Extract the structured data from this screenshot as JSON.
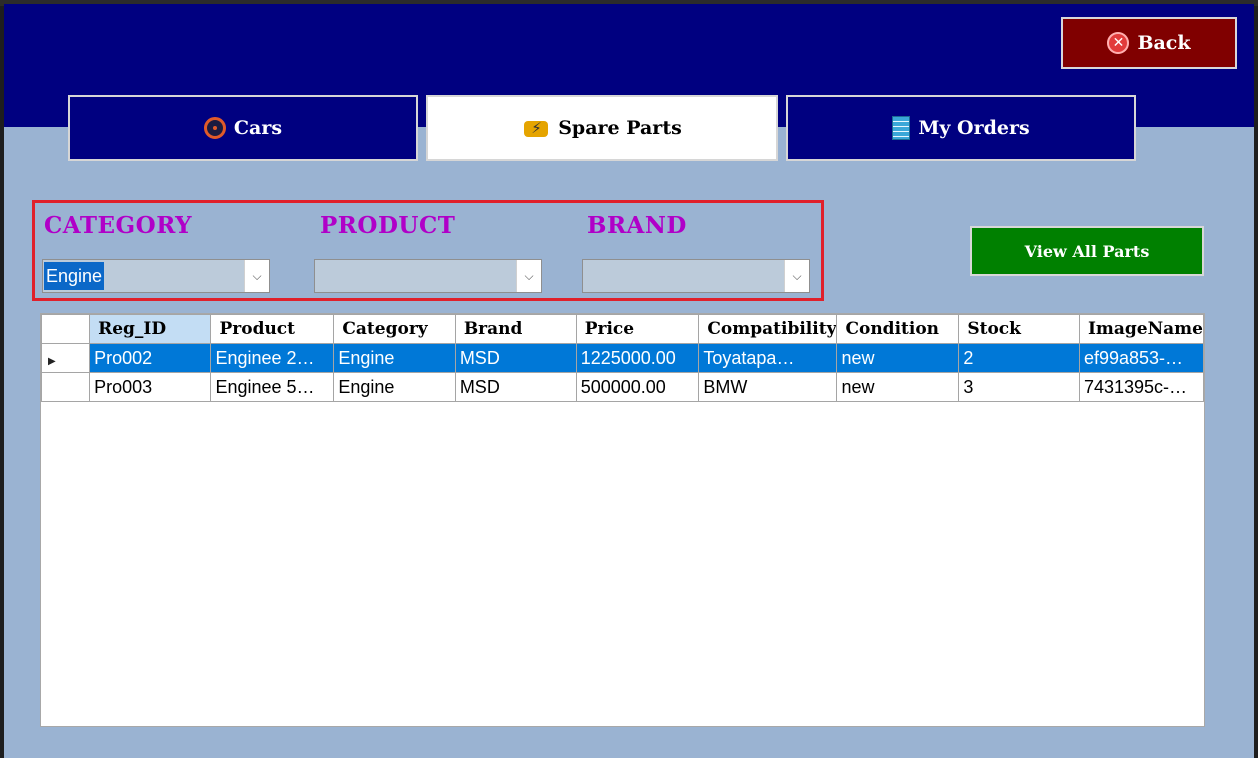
{
  "header": {
    "back_label": "Back"
  },
  "tabs": [
    {
      "label": "Cars",
      "icon": "steering-wheel-icon",
      "active": false
    },
    {
      "label": "Spare Parts",
      "icon": "engine-icon",
      "active": true
    },
    {
      "label": "My Orders",
      "icon": "receipt-icon",
      "active": false
    }
  ],
  "filters": {
    "category_label": "CATEGORY",
    "category_value": "Engine",
    "product_label": "PRODUCT",
    "product_value": "",
    "brand_label": "BRAND",
    "brand_value": ""
  },
  "view_all_label": "View All Parts",
  "grid": {
    "columns": [
      "Reg_ID",
      "Product",
      "Category",
      "Brand",
      "Price",
      "Compatibility",
      "Condition",
      "Stock",
      "ImageName"
    ],
    "rows": [
      [
        "Pro002",
        "Enginee 2…",
        "Engine",
        "MSD",
        "1225000.00",
        "Toyatapa…",
        "new",
        "2",
        "ef99a853-…"
      ],
      [
        "Pro003",
        "Enginee 5…",
        "Engine",
        "MSD",
        "500000.00",
        "BMW",
        "new",
        "3",
        "7431395c-…"
      ]
    ]
  },
  "colors": {
    "header": "#000080",
    "background": "#9ab3d2",
    "back_button": "#800000",
    "view_all_button": "#008000",
    "filter_label": "#b000c8",
    "filter_border": "#e0202b",
    "selection": "#0078d7"
  }
}
